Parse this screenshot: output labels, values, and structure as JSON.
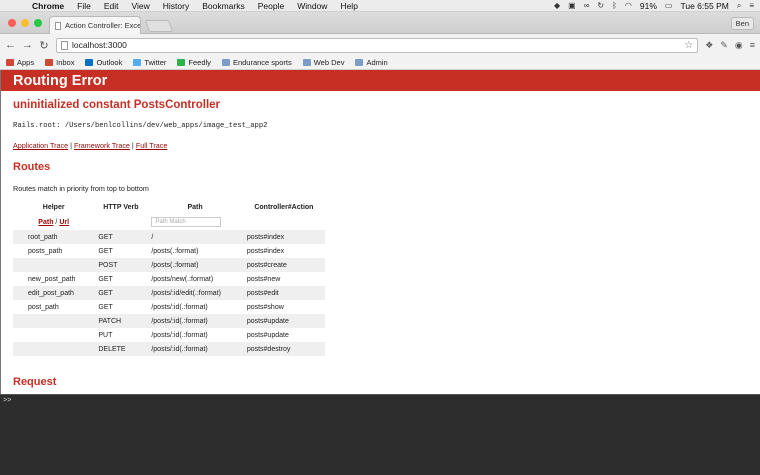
{
  "menubar": {
    "app": "Chrome",
    "items": [
      "File",
      "Edit",
      "View",
      "History",
      "Bookmarks",
      "People",
      "Window",
      "Help"
    ],
    "battery": "91%",
    "clock": "Tue 6:55 PM"
  },
  "tab": {
    "title": "Action Controller: Exceptio"
  },
  "user_button": "Ben",
  "address": "localhost:3000",
  "bookmarks": [
    {
      "label": "Apps",
      "icon": "apps-icon",
      "color": "#d14836"
    },
    {
      "label": "Inbox",
      "icon": "gmail-icon",
      "color": "#d14836"
    },
    {
      "label": "Outlook",
      "icon": "outlook-icon",
      "color": "#0072c6"
    },
    {
      "label": "Twitter",
      "icon": "twitter-icon",
      "color": "#55acee"
    },
    {
      "label": "Feedly",
      "icon": "feedly-icon",
      "color": "#2bb24c"
    },
    {
      "label": "Endurance sports",
      "icon": "folder-icon",
      "color": "#7a9cc6"
    },
    {
      "label": "Web Dev",
      "icon": "folder-icon",
      "color": "#7a9cc6"
    },
    {
      "label": "Admin",
      "icon": "folder-icon",
      "color": "#7a9cc6"
    }
  ],
  "page": {
    "header": "Routing Error",
    "error": "uninitialized constant PostsController",
    "rails_root": "Rails.root: /Users/benlcollins/dev/web_apps/image_test_app2",
    "traces": [
      "Application Trace",
      "Framework Trace",
      "Full Trace"
    ],
    "routes_title": "Routes",
    "routes_note": "Routes match in priority from top to bottom",
    "columns": [
      "Helper",
      "HTTP Verb",
      "Path",
      "Controller#Action"
    ],
    "helper_links": {
      "path": "Path",
      "url": "Url",
      "sep": "/"
    },
    "path_placeholder": "Path Match",
    "rows": [
      {
        "helper": "root_path",
        "verb": "GET",
        "path": "/",
        "action": "posts#index"
      },
      {
        "helper": "posts_path",
        "verb": "GET",
        "path": "/posts(.:format)",
        "action": "posts#index"
      },
      {
        "helper": "",
        "verb": "POST",
        "path": "/posts(.:format)",
        "action": "posts#create"
      },
      {
        "helper": "new_post_path",
        "verb": "GET",
        "path": "/posts/new(.:format)",
        "action": "posts#new"
      },
      {
        "helper": "edit_post_path",
        "verb": "GET",
        "path": "/posts/:id/edit(.:format)",
        "action": "posts#edit"
      },
      {
        "helper": "post_path",
        "verb": "GET",
        "path": "/posts/:id(.:format)",
        "action": "posts#show"
      },
      {
        "helper": "",
        "verb": "PATCH",
        "path": "/posts/:id(.:format)",
        "action": "posts#update"
      },
      {
        "helper": "",
        "verb": "PUT",
        "path": "/posts/:id(.:format)",
        "action": "posts#update"
      },
      {
        "helper": "",
        "verb": "DELETE",
        "path": "/posts/:id(.:format)",
        "action": "posts#destroy"
      }
    ],
    "request_title": "Request"
  },
  "terminal": {
    "prompt": ">>"
  }
}
